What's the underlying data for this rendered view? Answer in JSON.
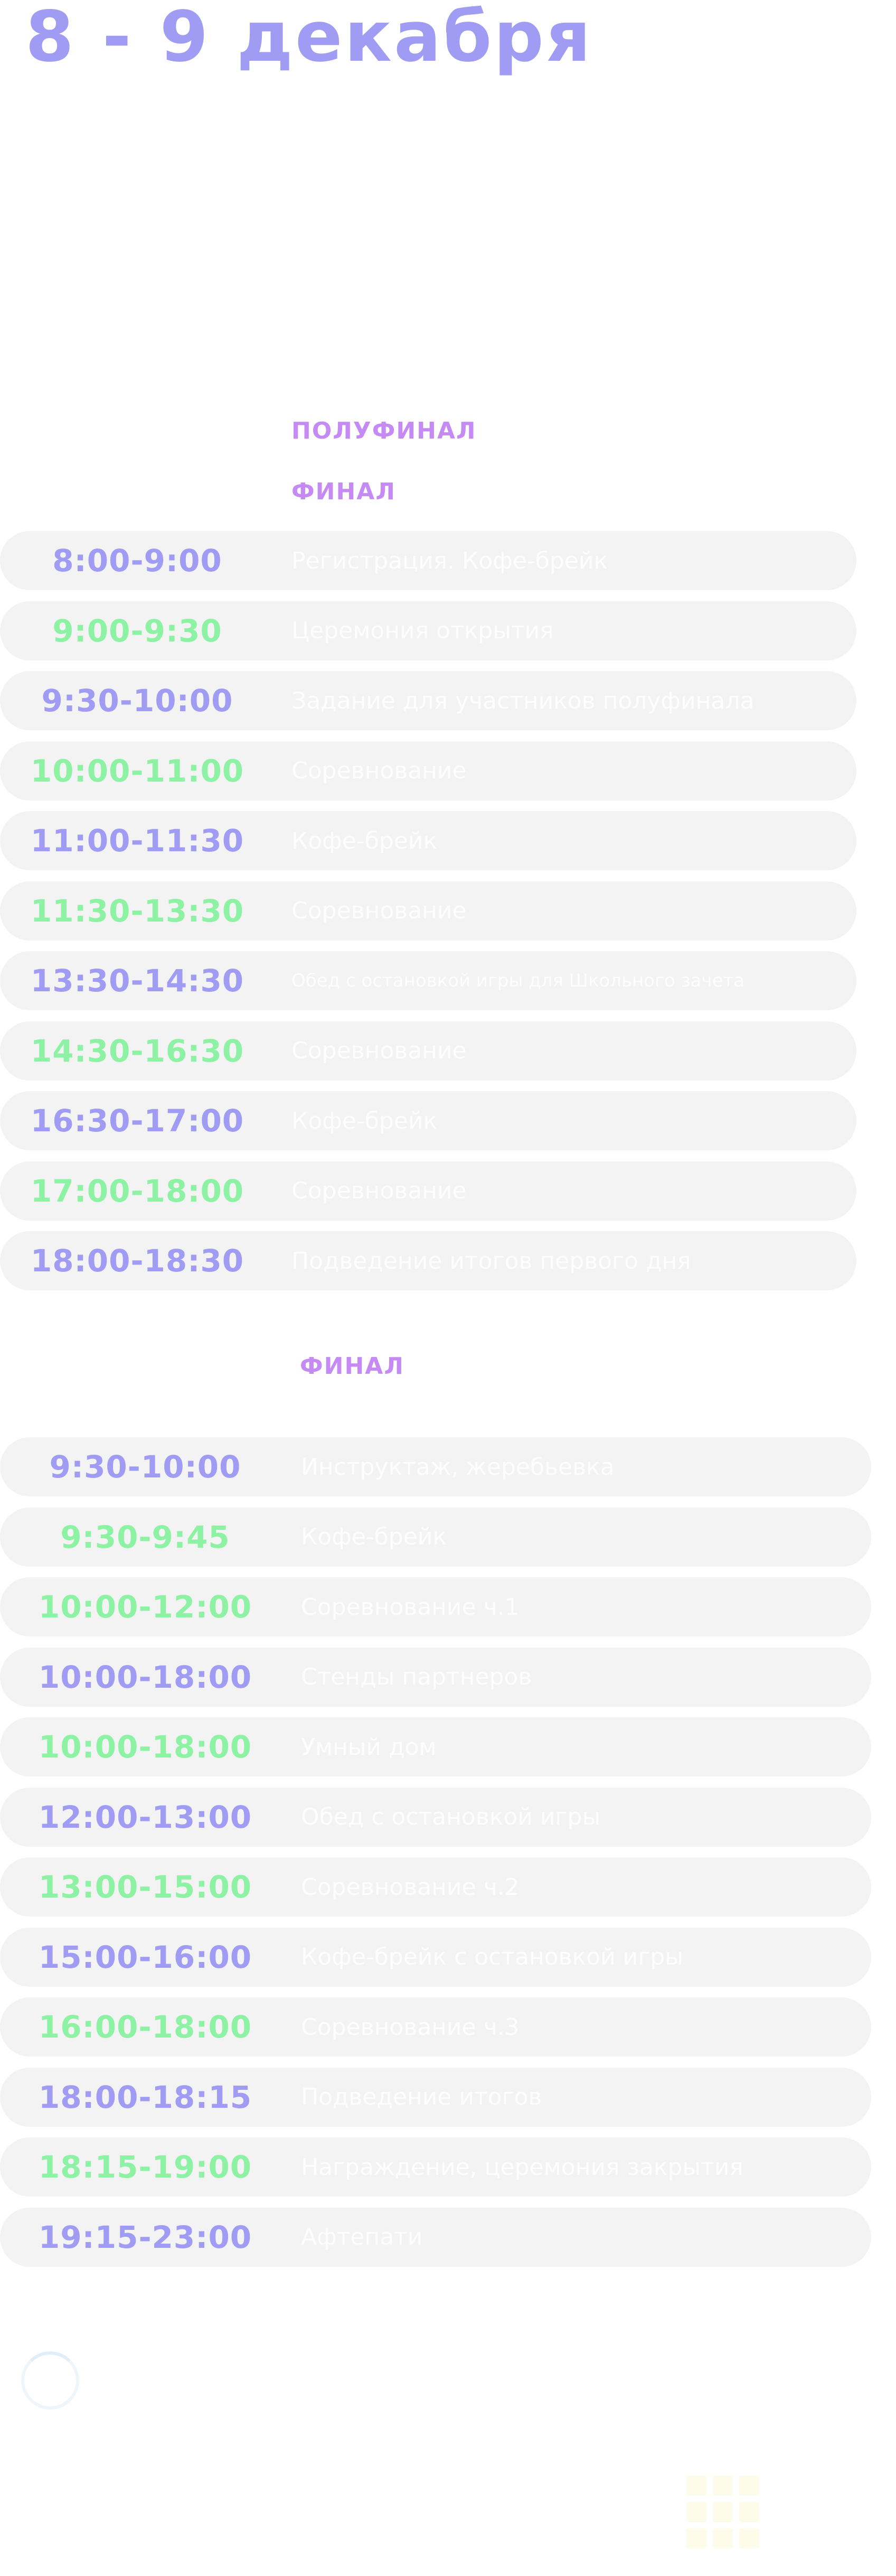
{
  "header": {
    "title": "8 - 9 декабря"
  },
  "sections": {
    "semifinal_label": "ПОЛУФИНАЛ",
    "final_label_top": "ФИНАЛ",
    "final_label_day2": "ФИНАЛ"
  },
  "day1": [
    {
      "time": "8:00-9:00",
      "text": "Регистрация. Кофе-брейк",
      "accent": "purple"
    },
    {
      "time": "9:00-9:30",
      "text": "Церемония открытия",
      "accent": "green"
    },
    {
      "time": "9:30-10:00",
      "text": "Задание для участников полуфинала",
      "accent": "purple"
    },
    {
      "time": "10:00-11:00",
      "text": "Соревнование",
      "accent": "green"
    },
    {
      "time": "11:00-11:30",
      "text": "Кофе-брейк",
      "accent": "purple"
    },
    {
      "time": "11:30-13:30",
      "text": "Соревнование",
      "accent": "green"
    },
    {
      "time": "13:30-14:30",
      "text": "Обед с остановкой игры для Школьного зачета",
      "accent": "purple"
    },
    {
      "time": "14:30-16:30",
      "text": "Соревнование",
      "accent": "green"
    },
    {
      "time": "16:30-17:00",
      "text": "Кофе-брейк",
      "accent": "purple"
    },
    {
      "time": "17:00-18:00",
      "text": "Соревнование",
      "accent": "green"
    },
    {
      "time": "18:00-18:30",
      "text": "Подведение итогов первого дня",
      "accent": "purple"
    }
  ],
  "day2": [
    {
      "time": "9:30-10:00",
      "text": "Инструктаж, жеребьевка",
      "accent": "purple"
    },
    {
      "time": "9:30-9:45",
      "text": "Кофе-брейк",
      "accent": "green"
    },
    {
      "time": "10:00-12:00",
      "text": "Соревнование ч.1",
      "accent": "green"
    },
    {
      "time": "10:00-18:00",
      "text": "Стенды партнеров",
      "accent": "purple"
    },
    {
      "time": "10:00-18:00",
      "text": "Умный дом",
      "accent": "green"
    },
    {
      "time": "12:00-13:00",
      "text": "Обед с остановкой игры",
      "accent": "purple"
    },
    {
      "time": "13:00-15:00",
      "text": "Соревнование ч.2",
      "accent": "green"
    },
    {
      "time": "15:00-16:00",
      "text": "Кофе-брейк с остановкой игры",
      "accent": "purple"
    },
    {
      "time": "16:00-18:00",
      "text": "Соревнование ч.3",
      "accent": "green"
    },
    {
      "time": "18:00-18:15",
      "text": "Подведение итогов",
      "accent": "purple"
    },
    {
      "time": "18:15-19:00",
      "text": "Награждение, церемония закрытия",
      "accent": "green"
    },
    {
      "time": "19:15-23:00",
      "text": "Афтепати",
      "accent": "purple"
    }
  ],
  "colors": {
    "title": "#a09cf3",
    "section_label": "#c58af3",
    "time_purple": "#a09cf3",
    "time_green": "#8ef2a4",
    "row_background": "#f3f3f3",
    "row_text": "#fdfdfd"
  },
  "icons": {
    "loader": "loading-spinner-icon",
    "decor": "grid-pattern-icon"
  }
}
